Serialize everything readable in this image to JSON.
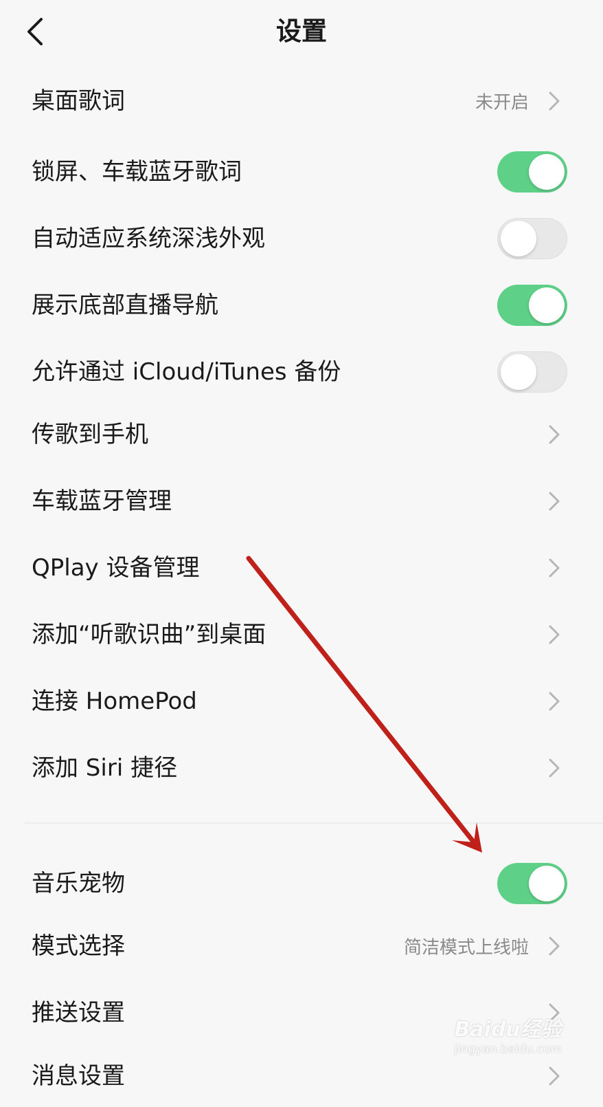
{
  "header": {
    "title": "设置",
    "back_icon": "chevron-left-icon"
  },
  "rows": [
    {
      "label": "桌面歌词",
      "value": "未开启",
      "control": "chevron"
    },
    {
      "label": "锁屏、车载蓝牙歌词",
      "control": "toggle",
      "state": "on"
    },
    {
      "label": "自动适应系统深浅外观",
      "control": "toggle",
      "state": "off"
    },
    {
      "label": "展示底部直播导航",
      "control": "toggle",
      "state": "on"
    },
    {
      "label": "允许通过 iCloud/iTunes 备份",
      "control": "toggle",
      "state": "off"
    },
    {
      "label": "传歌到手机",
      "control": "chevron"
    },
    {
      "label": "车载蓝牙管理",
      "control": "chevron"
    },
    {
      "label": "QPlay 设备管理",
      "control": "chevron"
    },
    {
      "label": "添加“听歌识曲”到桌面",
      "control": "chevron"
    },
    {
      "label": "连接 HomePod",
      "control": "chevron"
    },
    {
      "label": "添加 Siri 捷径",
      "control": "chevron"
    },
    {
      "label": "音乐宠物",
      "control": "toggle",
      "state": "on"
    },
    {
      "label": "模式选择",
      "value": "简洁模式上线啦",
      "control": "chevron"
    },
    {
      "label": "推送设置",
      "control": "chevron"
    },
    {
      "label": "消息设置",
      "control": "chevron"
    }
  ],
  "colors": {
    "toggle_on": "#5ed087",
    "toggle_off": "#e8e8e8",
    "annotation_arrow": "#c0201a",
    "background": "#f7f7f7"
  },
  "watermark": {
    "main": "Baidu经验",
    "sub": "jingyan.baidu.com"
  }
}
